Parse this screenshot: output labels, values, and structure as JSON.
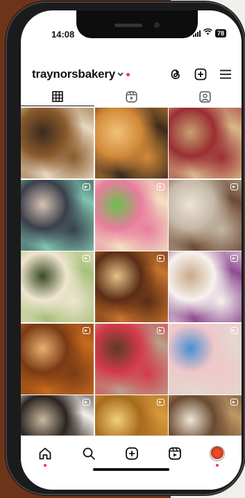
{
  "status_bar": {
    "time": "14:08",
    "battery": "78"
  },
  "profile": {
    "username": "traynorsbakery"
  },
  "header_icons": [
    "threads-icon",
    "create-post-icon",
    "menu-icon"
  ],
  "tabs": [
    "grid-posts-tab",
    "reels-tab",
    "tagged-tab"
  ],
  "active_tab": "grid-posts-tab",
  "grid": [
    {
      "reel": false,
      "colors": [
        "#e8d9c2",
        "#8a5a2b",
        "#3a2a1e"
      ]
    },
    {
      "reel": false,
      "colors": [
        "#3b2a1c",
        "#d28a3a",
        "#f0c27a"
      ]
    },
    {
      "reel": false,
      "colors": [
        "#d9b98a",
        "#9a2e33",
        "#c7a070"
      ]
    },
    {
      "reel": true,
      "colors": [
        "#7fc4b0",
        "#3a3f4a",
        "#d7c2b2"
      ]
    },
    {
      "reel": true,
      "colors": [
        "#f2e1c0",
        "#e87d9e",
        "#6bbf4d"
      ]
    },
    {
      "reel": true,
      "colors": [
        "#6e4a34",
        "#c5b8a6",
        "#ece4d6"
      ]
    },
    {
      "reel": true,
      "colors": [
        "#a7c07a",
        "#efe6d0",
        "#3a4a22"
      ]
    },
    {
      "reel": true,
      "colors": [
        "#c8742e",
        "#5b2c14",
        "#e5c18a"
      ]
    },
    {
      "reel": true,
      "colors": [
        "#8d4c91",
        "#f7f2ee",
        "#caa98a"
      ]
    },
    {
      "reel": true,
      "colors": [
        "#c86a1e",
        "#7a3a14",
        "#e8b070"
      ]
    },
    {
      "reel": true,
      "colors": [
        "#b9a08a",
        "#d43a4a",
        "#5c3a26"
      ]
    },
    {
      "reel": true,
      "colors": [
        "#e2d8cf",
        "#f0c7c9",
        "#4a8fd3"
      ]
    },
    {
      "reel": true,
      "colors": [
        "#f4f0ea",
        "#2b2420",
        "#c9b8a0"
      ]
    },
    {
      "reel": true,
      "colors": [
        "#d89a3c",
        "#a86a1c",
        "#f2cf7a"
      ]
    },
    {
      "reel": true,
      "colors": [
        "#c09866",
        "#6a4a30",
        "#efe6d6"
      ]
    }
  ],
  "bottom_nav": [
    "home-icon",
    "search-icon",
    "create-icon",
    "reels-icon",
    "profile-avatar"
  ],
  "colors": {
    "notification_dot": "#ff2d55",
    "text": "#111111"
  }
}
